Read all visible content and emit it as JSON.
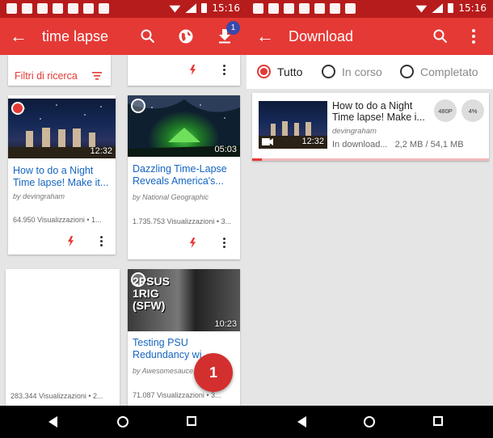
{
  "status_bar": {
    "time": "15:16"
  },
  "left": {
    "appbar": {
      "title": "time lapse",
      "badge": "1"
    },
    "filter_label": "Filtri di ricerca",
    "cards": [
      {
        "title": "How to do a Night Time lapse! Make it...",
        "author": "by devingraham",
        "views": "64.950 Visualizzazioni • 1...",
        "duration": "12:32"
      },
      {
        "title": "Dazzling Time-Lapse Reveals America's...",
        "author": "by National Geographic",
        "views": "1.735.753 Visualizzazioni • 3...",
        "duration": "05:03"
      },
      {
        "title": "",
        "author": "",
        "views": "283.344 Visualizzazioni • 2...",
        "duration": ""
      },
      {
        "title": "Testing PSU Redundancy wi...",
        "author": "by Awesomesauce...",
        "views": "71.087 Visualizzazioni • 3...",
        "duration": "10:23",
        "thumb_text": "2PSUS 1RIG (SFW)"
      }
    ],
    "callout": "1"
  },
  "right": {
    "appbar": {
      "title": "Download"
    },
    "tabs": [
      {
        "label": "Tutto",
        "selected": true
      },
      {
        "label": "In corso",
        "selected": false
      },
      {
        "label": "Completato",
        "selected": false
      }
    ],
    "download": {
      "title": "How to do a Night Time lapse! Make i...",
      "author": "devingraham",
      "status": "In download...",
      "size": "2,2 MB / 54,1 MB",
      "quality": "480P",
      "percent": "4%",
      "duration": "12:32",
      "progress": 0.04
    }
  },
  "colors": {
    "primary": "#e53935",
    "status_bar": "#b71c1c",
    "link": "#1565c0",
    "badge": "#3949ab"
  }
}
